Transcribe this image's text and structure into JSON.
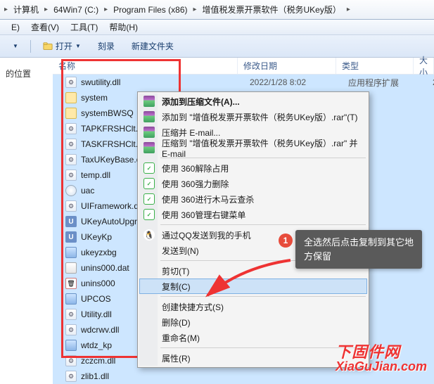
{
  "breadcrumb": {
    "items": [
      "计算机",
      "64Win7 (C:)",
      "Program Files (x86)",
      "增值税发票开票软件（税务UKey版）"
    ]
  },
  "menubar": {
    "items": [
      {
        "label": "E)"
      },
      {
        "label": "查看(V)"
      },
      {
        "label": "工具(T)"
      },
      {
        "label": "帮助(H)"
      }
    ]
  },
  "toolbar": {
    "open": "打开",
    "burn": "刻录",
    "newfolder": "新建文件夹"
  },
  "navpane": {
    "location": "的位置"
  },
  "columns": {
    "name": "名称",
    "date": "修改日期",
    "type": "类型",
    "size": "大小"
  },
  "files": [
    {
      "name": "swutility.dll",
      "icon": "i-dll",
      "date": "2022/1/28 8:02",
      "type": "应用程序扩展",
      "size": "2"
    },
    {
      "name": "system",
      "icon": "i-folder"
    },
    {
      "name": "systemBWSQ",
      "icon": "i-folder"
    },
    {
      "name": "TAPKFRSHClt.dll",
      "icon": "i-dll"
    },
    {
      "name": "TASKFRSHClt.dll",
      "icon": "i-dll"
    },
    {
      "name": "TaxUKeyBase.dll",
      "icon": "i-dll"
    },
    {
      "name": "temp.dll",
      "icon": "i-dll"
    },
    {
      "name": "uac",
      "icon": "i-shield"
    },
    {
      "name": "UIFramework.dll",
      "icon": "i-dll"
    },
    {
      "name": "UKeyAutoUpgrade",
      "icon": "i-u"
    },
    {
      "name": "UKeyKp",
      "icon": "i-u"
    },
    {
      "name": "ukeyzxbg",
      "icon": "i-exe"
    },
    {
      "name": "unins000.dat",
      "icon": "i-db"
    },
    {
      "name": "unins000",
      "icon": "i-del"
    },
    {
      "name": "UPCOS",
      "icon": "i-exe"
    },
    {
      "name": "Utility.dll",
      "icon": "i-dll"
    },
    {
      "name": "wdcrwv.dll",
      "icon": "i-dll"
    },
    {
      "name": "wtdz_kp",
      "icon": "i-exe"
    },
    {
      "name": "zczcm.dll",
      "icon": "i-dll"
    },
    {
      "name": "zlib1.dll",
      "icon": "i-dll"
    }
  ],
  "contextmenu": {
    "items": [
      {
        "label": "添加到压缩文件(A)...",
        "icon": "i-rar",
        "bold": true
      },
      {
        "label": "添加到 \"增值税发票开票软件（税务UKey版）.rar\"(T)",
        "icon": "i-rar"
      },
      {
        "label": "压缩并 E-mail...",
        "icon": "i-rar"
      },
      {
        "label": "压缩到 \"增值税发票开票软件（税务UKey版）.rar\" 并 E-mail",
        "icon": "i-rar"
      },
      {
        "sep": true
      },
      {
        "label": "使用 360解除占用",
        "icon": "i-360"
      },
      {
        "label": "使用 360强力删除",
        "icon": "i-360"
      },
      {
        "label": "使用 360进行木马云查杀",
        "icon": "i-360"
      },
      {
        "label": "使用 360管理右键菜单",
        "icon": "i-360"
      },
      {
        "sep": true
      },
      {
        "label": "通过QQ发送到我的手机",
        "icon": "i-qq"
      },
      {
        "label": "发送到(N)",
        "submenu": true
      },
      {
        "sep": true
      },
      {
        "label": "剪切(T)"
      },
      {
        "label": "复制(C)",
        "hover": true
      },
      {
        "sep": true
      },
      {
        "label": "创建快捷方式(S)"
      },
      {
        "label": "删除(D)"
      },
      {
        "label": "重命名(M)"
      },
      {
        "sep": true
      },
      {
        "label": "属性(R)"
      }
    ]
  },
  "callout": {
    "badge": "1",
    "text": "全选然后点击复制到其它地方保留"
  },
  "watermark": {
    "cn": "下固件网",
    "en": "XiaGuJian.com"
  }
}
